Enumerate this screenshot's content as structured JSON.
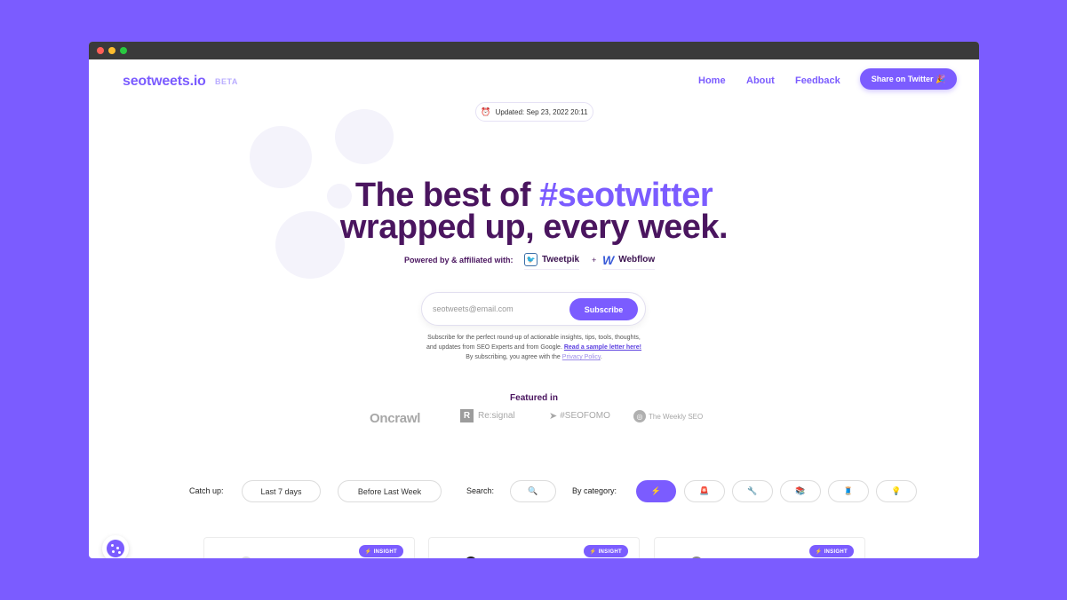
{
  "brand": {
    "name": "seotweets.io",
    "badge": "BETA"
  },
  "nav": {
    "home": "Home",
    "about": "About",
    "feedback": "Feedback",
    "share": "Share on Twitter 🎉"
  },
  "updated": {
    "icon": "alarm-clock-icon",
    "glyph": "⏰",
    "text": "Updated: Sep 23, 2022 20:11"
  },
  "hero": {
    "line1_prefix": "The best of ",
    "line1_accent": "#seotwitter",
    "line2": "wrapped up, every week."
  },
  "powered": {
    "label": "Powered by & affiliated with:",
    "partners": [
      {
        "name": "Tweetpik",
        "icon": "tweetpik-logo",
        "glyph": "🐦"
      },
      {
        "name": "Webflow",
        "icon": "webflow-logo",
        "glyph": "W"
      }
    ],
    "plus": "+"
  },
  "subscribe": {
    "placeholder": "seotweets@email.com",
    "button": "Subscribe",
    "desc_line1": "Subscribe for the perfect round-up of actionable insights, tips, tools, thoughts,",
    "desc_line2_prefix": "and updates from SEO Experts and from Google.",
    "sample_link": "Read a sample letter here!",
    "agree_prefix": "By subscribing, you agree with the",
    "privacy_link": "Privacy Policy",
    "agree_suffix": "."
  },
  "featured": {
    "title": "Featured in",
    "logos": [
      {
        "name": "Oncrawl"
      },
      {
        "name": "Re:signal",
        "mark": "R"
      },
      {
        "name": "#SEOFOMO",
        "mark": "paper-plane-icon"
      },
      {
        "name": "The Weekly SEO",
        "mark": "magnifier-icon"
      }
    ]
  },
  "filters": {
    "catch_up_label": "Catch up:",
    "last7": "Last 7 days",
    "before_last": "Before Last Week",
    "search_label": "Search:",
    "search_glyph": "🔍",
    "category_label": "By category:",
    "categories": [
      {
        "icon": "lightning-icon",
        "glyph": "⚡",
        "active": true
      },
      {
        "icon": "siren-icon",
        "glyph": "🚨",
        "active": false
      },
      {
        "icon": "wrench-icon",
        "glyph": "🔧",
        "active": false
      },
      {
        "icon": "books-icon",
        "glyph": "📚",
        "active": false
      },
      {
        "icon": "thread-icon",
        "glyph": "🧵",
        "active": false
      },
      {
        "icon": "lightbulb-icon",
        "glyph": "💡",
        "active": false
      }
    ]
  },
  "cards": [
    {
      "badge": "⚡ INSIGHT"
    },
    {
      "badge": "⚡ INSIGHT"
    },
    {
      "badge": "⚡ INSIGHT"
    }
  ],
  "colors": {
    "accent": "#7b5cff",
    "headline": "#4a155f",
    "background": "#7b5cff"
  }
}
